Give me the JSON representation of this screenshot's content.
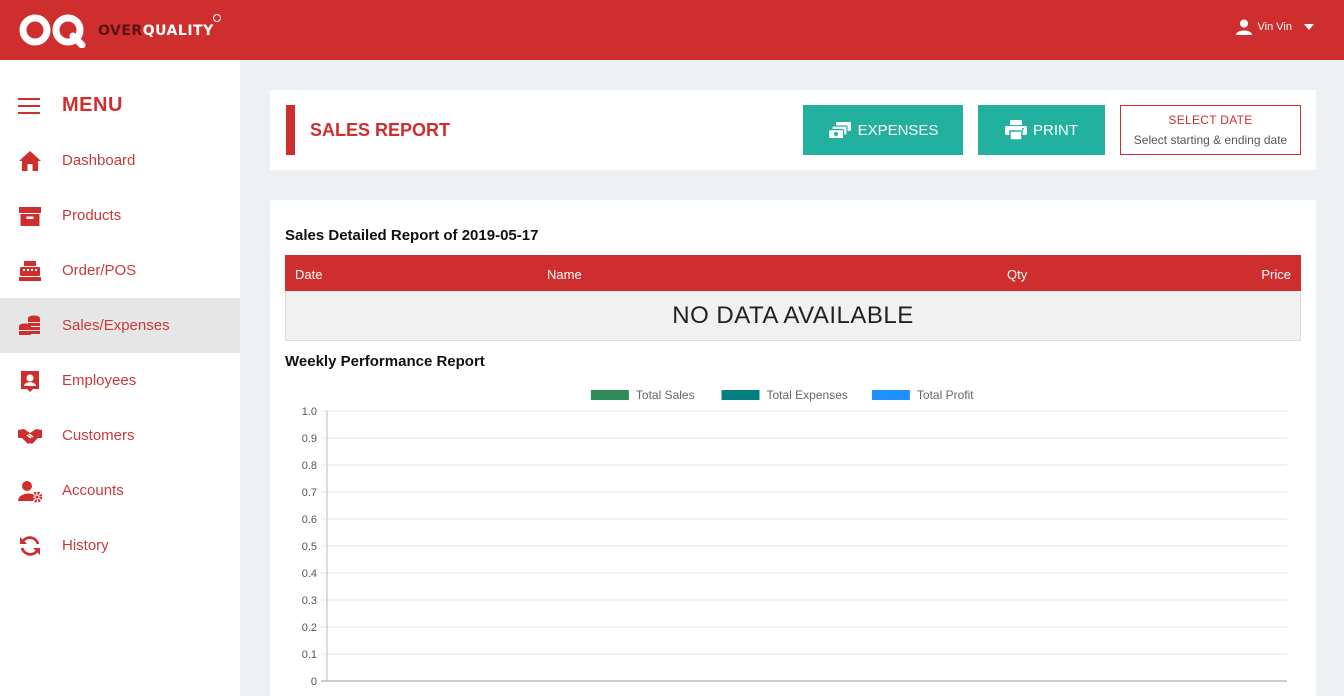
{
  "app": {
    "logo_main": "OVER",
    "logo_accent": "QUALITY",
    "user_name": "Vin Vin"
  },
  "sidebar": {
    "title": "MENU",
    "items": [
      {
        "label": "Dashboard",
        "icon": "home-icon"
      },
      {
        "label": "Products",
        "icon": "archive-box-icon"
      },
      {
        "label": "Order/POS",
        "icon": "cash-register-icon"
      },
      {
        "label": "Sales/Expenses",
        "icon": "coins-icon",
        "active": true
      },
      {
        "label": "Employees",
        "icon": "id-badge-icon"
      },
      {
        "label": "Customers",
        "icon": "handshake-icon"
      },
      {
        "label": "Accounts",
        "icon": "user-gear-icon"
      },
      {
        "label": "History",
        "icon": "refresh-icon"
      }
    ]
  },
  "header": {
    "title": "SALES REPORT",
    "expenses_label": "EXPENSES",
    "print_label": "PRINT",
    "select_date_label": "SELECT DATE",
    "select_date_hint": "Select starting & ending date"
  },
  "report": {
    "detailed_title": "Sales Detailed Report of 2019-05-17",
    "columns": [
      "Date",
      "Name",
      "Qty",
      "Price"
    ],
    "empty_text": "NO DATA AVAILABLE",
    "weekly_title": "Weekly Performance Report"
  },
  "colors": {
    "brand": "#cf2e2e",
    "accent": "#22b19e"
  },
  "chart_data": {
    "type": "bar",
    "categories": [],
    "series": [
      {
        "name": "Total Sales",
        "color": "#2e8b57",
        "values": []
      },
      {
        "name": "Total Expenses",
        "color": "#008080",
        "values": []
      },
      {
        "name": "Total Profit",
        "color": "#1e90ff",
        "values": []
      }
    ],
    "yticks": [
      "1.0",
      "0.9",
      "0.8",
      "0.7",
      "0.6",
      "0.5",
      "0.4",
      "0.3",
      "0.2",
      "0.1",
      "0"
    ],
    "ylim": [
      0,
      1
    ],
    "legend": "top-center",
    "grid": true
  }
}
